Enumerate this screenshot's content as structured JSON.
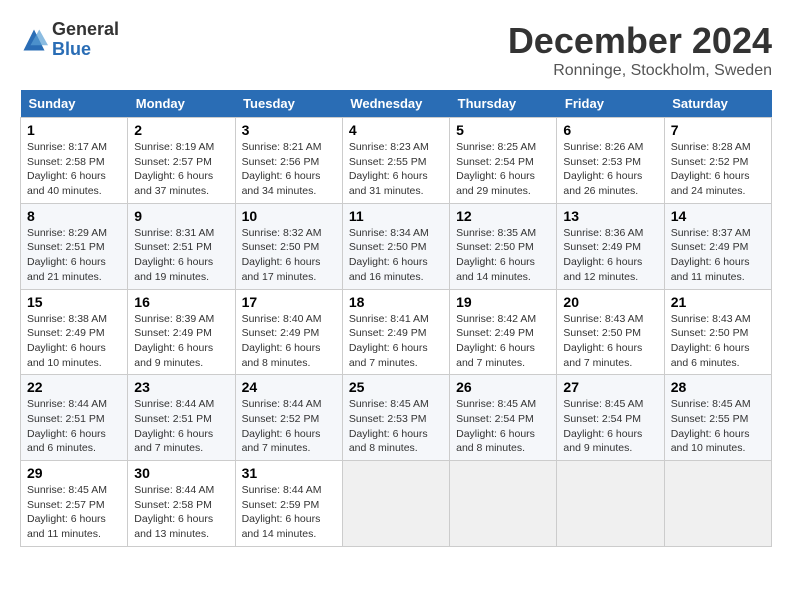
{
  "logo": {
    "general": "General",
    "blue": "Blue"
  },
  "title": "December 2024",
  "subtitle": "Ronninge, Stockholm, Sweden",
  "days_of_week": [
    "Sunday",
    "Monday",
    "Tuesday",
    "Wednesday",
    "Thursday",
    "Friday",
    "Saturday"
  ],
  "weeks": [
    [
      {
        "day": "1",
        "info": "Sunrise: 8:17 AM\nSunset: 2:58 PM\nDaylight: 6 hours\nand 40 minutes."
      },
      {
        "day": "2",
        "info": "Sunrise: 8:19 AM\nSunset: 2:57 PM\nDaylight: 6 hours\nand 37 minutes."
      },
      {
        "day": "3",
        "info": "Sunrise: 8:21 AM\nSunset: 2:56 PM\nDaylight: 6 hours\nand 34 minutes."
      },
      {
        "day": "4",
        "info": "Sunrise: 8:23 AM\nSunset: 2:55 PM\nDaylight: 6 hours\nand 31 minutes."
      },
      {
        "day": "5",
        "info": "Sunrise: 8:25 AM\nSunset: 2:54 PM\nDaylight: 6 hours\nand 29 minutes."
      },
      {
        "day": "6",
        "info": "Sunrise: 8:26 AM\nSunset: 2:53 PM\nDaylight: 6 hours\nand 26 minutes."
      },
      {
        "day": "7",
        "info": "Sunrise: 8:28 AM\nSunset: 2:52 PM\nDaylight: 6 hours\nand 24 minutes."
      }
    ],
    [
      {
        "day": "8",
        "info": "Sunrise: 8:29 AM\nSunset: 2:51 PM\nDaylight: 6 hours\nand 21 minutes."
      },
      {
        "day": "9",
        "info": "Sunrise: 8:31 AM\nSunset: 2:51 PM\nDaylight: 6 hours\nand 19 minutes."
      },
      {
        "day": "10",
        "info": "Sunrise: 8:32 AM\nSunset: 2:50 PM\nDaylight: 6 hours\nand 17 minutes."
      },
      {
        "day": "11",
        "info": "Sunrise: 8:34 AM\nSunset: 2:50 PM\nDaylight: 6 hours\nand 16 minutes."
      },
      {
        "day": "12",
        "info": "Sunrise: 8:35 AM\nSunset: 2:50 PM\nDaylight: 6 hours\nand 14 minutes."
      },
      {
        "day": "13",
        "info": "Sunrise: 8:36 AM\nSunset: 2:49 PM\nDaylight: 6 hours\nand 12 minutes."
      },
      {
        "day": "14",
        "info": "Sunrise: 8:37 AM\nSunset: 2:49 PM\nDaylight: 6 hours\nand 11 minutes."
      }
    ],
    [
      {
        "day": "15",
        "info": "Sunrise: 8:38 AM\nSunset: 2:49 PM\nDaylight: 6 hours\nand 10 minutes."
      },
      {
        "day": "16",
        "info": "Sunrise: 8:39 AM\nSunset: 2:49 PM\nDaylight: 6 hours\nand 9 minutes."
      },
      {
        "day": "17",
        "info": "Sunrise: 8:40 AM\nSunset: 2:49 PM\nDaylight: 6 hours\nand 8 minutes."
      },
      {
        "day": "18",
        "info": "Sunrise: 8:41 AM\nSunset: 2:49 PM\nDaylight: 6 hours\nand 7 minutes."
      },
      {
        "day": "19",
        "info": "Sunrise: 8:42 AM\nSunset: 2:49 PM\nDaylight: 6 hours\nand 7 minutes."
      },
      {
        "day": "20",
        "info": "Sunrise: 8:43 AM\nSunset: 2:50 PM\nDaylight: 6 hours\nand 7 minutes."
      },
      {
        "day": "21",
        "info": "Sunrise: 8:43 AM\nSunset: 2:50 PM\nDaylight: 6 hours\nand 6 minutes."
      }
    ],
    [
      {
        "day": "22",
        "info": "Sunrise: 8:44 AM\nSunset: 2:51 PM\nDaylight: 6 hours\nand 6 minutes."
      },
      {
        "day": "23",
        "info": "Sunrise: 8:44 AM\nSunset: 2:51 PM\nDaylight: 6 hours\nand 7 minutes."
      },
      {
        "day": "24",
        "info": "Sunrise: 8:44 AM\nSunset: 2:52 PM\nDaylight: 6 hours\nand 7 minutes."
      },
      {
        "day": "25",
        "info": "Sunrise: 8:45 AM\nSunset: 2:53 PM\nDaylight: 6 hours\nand 8 minutes."
      },
      {
        "day": "26",
        "info": "Sunrise: 8:45 AM\nSunset: 2:54 PM\nDaylight: 6 hours\nand 8 minutes."
      },
      {
        "day": "27",
        "info": "Sunrise: 8:45 AM\nSunset: 2:54 PM\nDaylight: 6 hours\nand 9 minutes."
      },
      {
        "day": "28",
        "info": "Sunrise: 8:45 AM\nSunset: 2:55 PM\nDaylight: 6 hours\nand 10 minutes."
      }
    ],
    [
      {
        "day": "29",
        "info": "Sunrise: 8:45 AM\nSunset: 2:57 PM\nDaylight: 6 hours\nand 11 minutes."
      },
      {
        "day": "30",
        "info": "Sunrise: 8:44 AM\nSunset: 2:58 PM\nDaylight: 6 hours\nand 13 minutes."
      },
      {
        "day": "31",
        "info": "Sunrise: 8:44 AM\nSunset: 2:59 PM\nDaylight: 6 hours\nand 14 minutes."
      },
      {
        "day": "",
        "info": ""
      },
      {
        "day": "",
        "info": ""
      },
      {
        "day": "",
        "info": ""
      },
      {
        "day": "",
        "info": ""
      }
    ]
  ]
}
